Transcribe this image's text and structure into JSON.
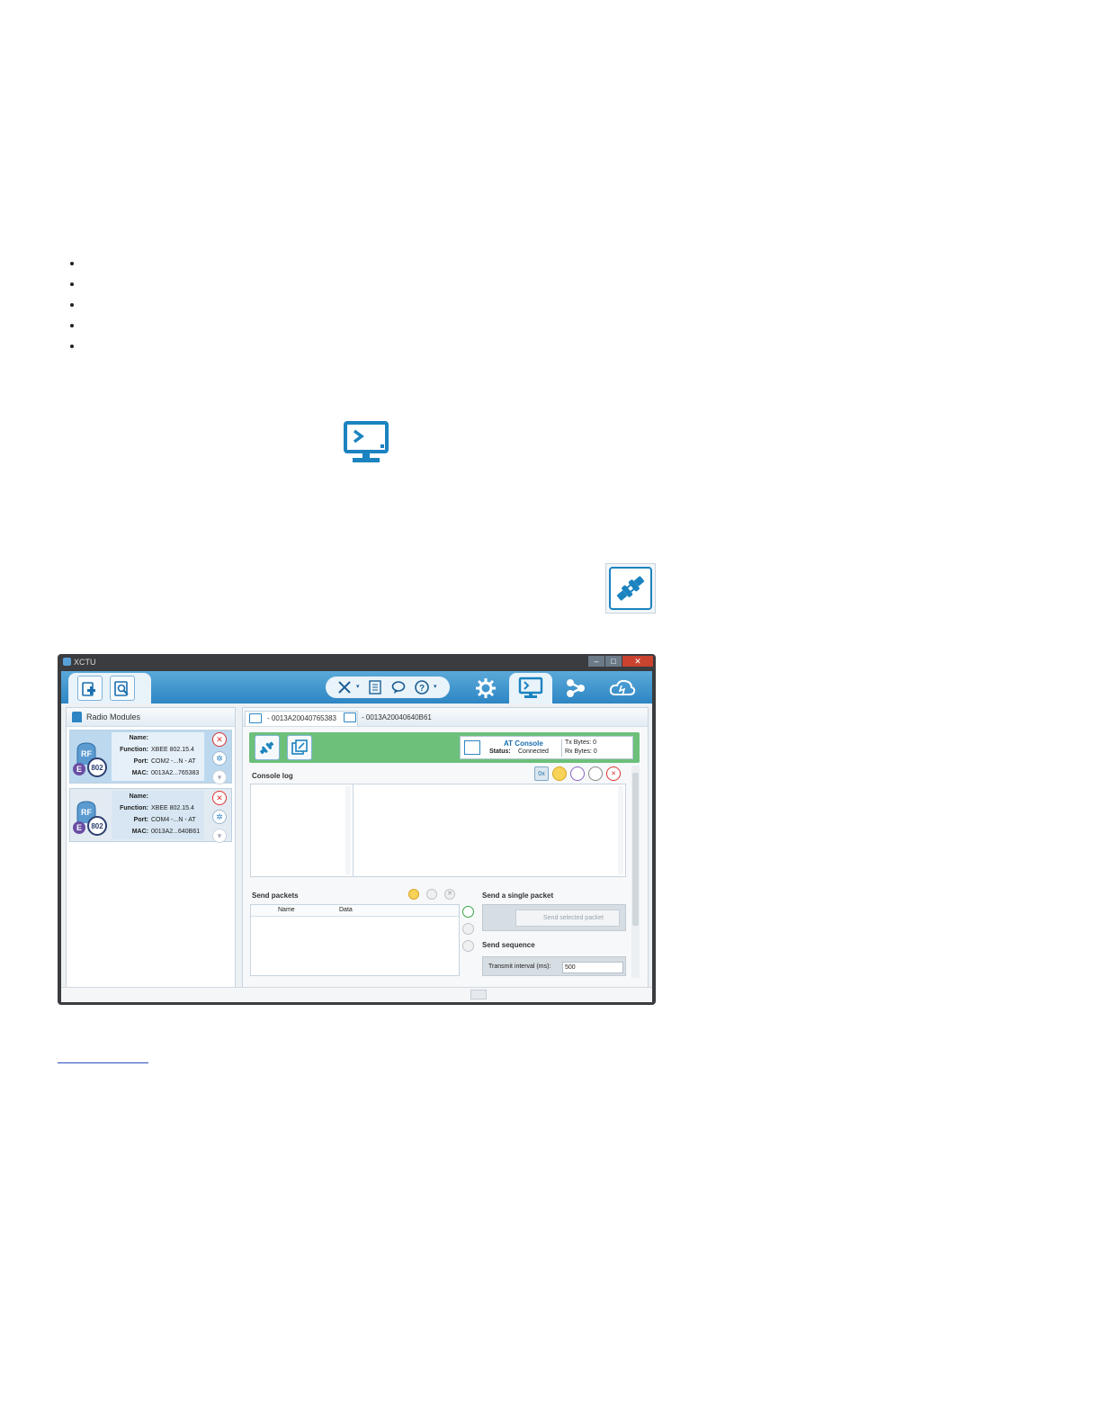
{
  "bullets": [
    "",
    "",
    "",
    "",
    ""
  ],
  "icons": {
    "console_icon": "console-monitor-icon",
    "connect_icon": "connect-plug-icon",
    "accent": "#1b83bf"
  },
  "window": {
    "title": "XCTU",
    "close_glyph": "✕",
    "left_panel": {
      "header": "Radio Modules",
      "modules": [
        {
          "name_label": "Name:",
          "name": "",
          "function_label": "Function:",
          "function": "XBEE 802.15.4",
          "port_label": "Port:",
          "port": "COM2 -...N - AT",
          "mac_label": "MAC:",
          "mac": "0013A2...765383"
        },
        {
          "name_label": "Name:",
          "name": "",
          "function_label": "Function:",
          "function": "XBEE 802.15.4",
          "port_label": "Port:",
          "port": "COM4 -...N - AT",
          "mac_label": "MAC:",
          "mac": "0013A2...640B61"
        }
      ],
      "badge_top": "RF",
      "badge_letter": "E",
      "badge_num": "802"
    },
    "tabs": [
      " - 0013A20040765383",
      " - 0013A20040640B61"
    ],
    "status": {
      "title": "AT Console",
      "status_label": "Status:",
      "status_value": "Connected",
      "tx": "Tx Bytes: 0",
      "rx": "Rx Bytes: 0"
    },
    "console_log": "Console log",
    "send_packets": {
      "title": "Send packets",
      "col_name": "Name",
      "col_data": "Data"
    },
    "send_single": "Send a single packet",
    "send_selected_button": "Send selected packet",
    "send_sequence": "Send sequence",
    "transmit_interval_label": "Transmit interval (ms):",
    "transmit_interval_value": "500",
    "hex_toggle": "0x"
  }
}
